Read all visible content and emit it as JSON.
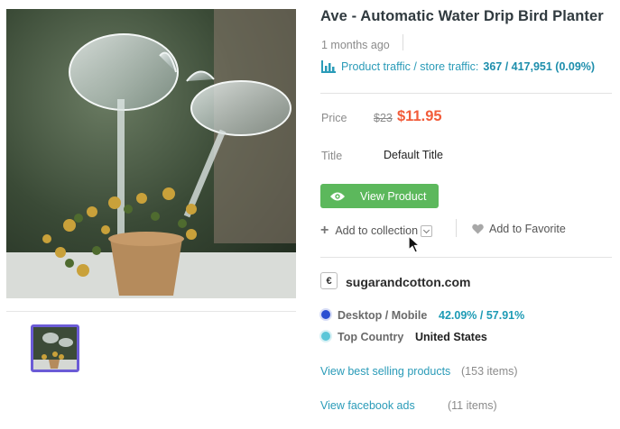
{
  "product": {
    "title": "Ave - Automatic Water Drip Bird Planter",
    "age": "1 months ago",
    "traffic_label": "Product traffic / store traffic:",
    "traffic_value": "367 / 417,951 (0.09%)",
    "price_label": "Price",
    "price_old": "$23",
    "price_new": "$11.95",
    "variant_label": "Title",
    "variant_value": "Default Title"
  },
  "actions": {
    "view_product": "View Product",
    "add_to_collection": "Add to collection",
    "add_to_favorite": "Add to Favorite"
  },
  "store": {
    "icon_glyph": "€",
    "name": "sugarandcotton.com",
    "device_label": "Desktop / Mobile",
    "device_value": "42.09% / 57.91%",
    "country_label": "Top Country",
    "country_value": "United States",
    "best_selling_link": "View best selling products",
    "best_selling_count": "(153 items)",
    "facebook_link": "View facebook ads",
    "facebook_count": "(11 items)"
  },
  "colors": {
    "accent_teal": "#2a9bb8",
    "price_red": "#f25c3a",
    "button_green": "#5cb85c",
    "thumb_border": "#6b5bd6",
    "desktop_dot": "#2b4fd1",
    "country_dot": "#5bc6d8"
  },
  "icons": {
    "traffic": "bar-chart-icon",
    "view": "eye-icon",
    "add": "plus-icon",
    "dropdown": "chevron-down-icon",
    "favorite": "heart-icon",
    "store": "store-logo-icon"
  }
}
